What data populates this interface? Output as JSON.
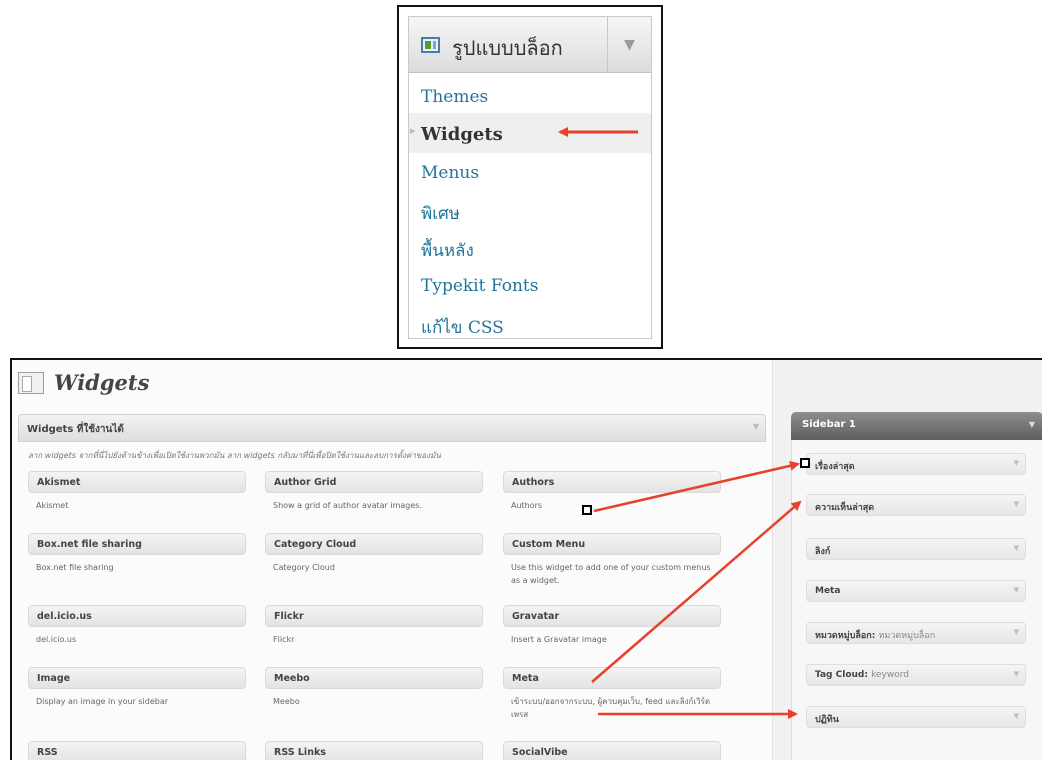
{
  "colors": {
    "arrow": "#e8402a",
    "link": "#21759b",
    "sidebar_header": "#6f6f6f"
  },
  "menu": {
    "icon": "appearance-icon",
    "title": "รูปแบบบล็อก",
    "toggle": "▼",
    "items": [
      "Themes",
      "Widgets",
      "Menus",
      "พิเศษ",
      "พื้นหลัง",
      "Typekit Fonts",
      "แก้ไข CSS"
    ],
    "active_item": "Widgets"
  },
  "page": {
    "icon": "widgets-page-icon",
    "title": "Widgets"
  },
  "available": {
    "title": "Widgets ที่ใช้งานได้",
    "toggle": "▼",
    "description": "ลาก widgets จากที่นี่ไปยังด้านข้างเพื่อเปิดใช้งานพวกมัน ลาก widgets กลับมาที่นี่เพื่อปิดใช้งานและลบการตั้งค่าของมัน",
    "widgets": [
      {
        "title": "Akismet",
        "desc": "Akismet"
      },
      {
        "title": "Author Grid",
        "desc": "Show a grid of author avatar images."
      },
      {
        "title": "Authors",
        "desc": "Authors"
      },
      {
        "title": "Box.net file sharing",
        "desc": "Box.net file sharing"
      },
      {
        "title": "Category Cloud",
        "desc": "Category Cloud"
      },
      {
        "title": "Custom Menu",
        "desc": "Use this widget to add one of your custom menus as a widget."
      },
      {
        "title": "del.icio.us",
        "desc": "del.icio.us"
      },
      {
        "title": "Flickr",
        "desc": "Flickr"
      },
      {
        "title": "Gravatar",
        "desc": "Insert a Gravatar image"
      },
      {
        "title": "Image",
        "desc": "Display an image in your sidebar"
      },
      {
        "title": "Meebo",
        "desc": "Meebo"
      },
      {
        "title": "Meta",
        "desc": "เข้าระบบ/ออกจากระบบ, ผู้ควบคุมเว็บ, feed และลิงก์เวิร์ดเพรส"
      },
      {
        "title": "RSS",
        "desc": ""
      },
      {
        "title": "RSS Links",
        "desc": ""
      },
      {
        "title": "SocialVibe",
        "desc": ""
      }
    ]
  },
  "sidebar": {
    "title": "Sidebar 1",
    "toggle": "▼",
    "widgets": [
      {
        "label": "เรื่องล่าสุด",
        "sub": ""
      },
      {
        "label": "ความเห็นล่าสุด",
        "sub": ""
      },
      {
        "label": "ลิงก์",
        "sub": ""
      },
      {
        "label": "Meta",
        "sub": ""
      },
      {
        "label": "หมวดหมู่บล็อก:",
        "sub": "หมวดหมู่บล็อก"
      },
      {
        "label": "Tag Cloud:",
        "sub": "keyword"
      },
      {
        "label": "ปฏิทิน",
        "sub": ""
      }
    ],
    "item_arrow": "▼"
  }
}
